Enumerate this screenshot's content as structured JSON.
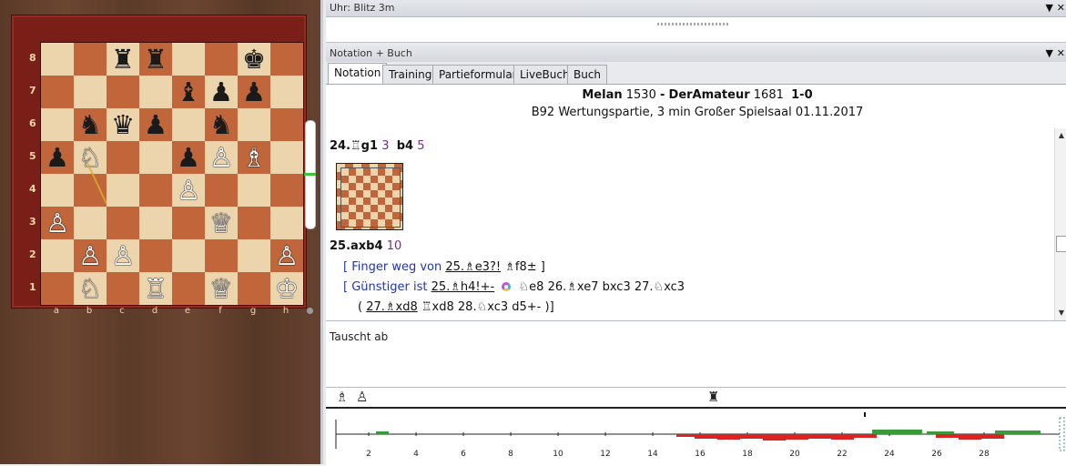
{
  "board": {
    "rank_labels": [
      "8",
      "7",
      "6",
      "5",
      "4",
      "3",
      "2",
      "1"
    ],
    "file_labels": [
      "a",
      "b",
      "c",
      "d",
      "e",
      "f",
      "g",
      "h"
    ],
    "rows": [
      [
        "",
        "",
        "bR",
        "bR",
        "",
        "",
        "bK",
        ""
      ],
      [
        "",
        "",
        "",
        "",
        "bB",
        "bP",
        "bP",
        ""
      ],
      [
        "",
        "bN",
        "bQ",
        "bP",
        "",
        "bN",
        "",
        ""
      ],
      [
        "bP",
        "wN",
        "",
        "",
        "bP",
        "wP",
        "wB",
        ""
      ],
      [
        "",
        "",
        "",
        "",
        "wP",
        "",
        "",
        ""
      ],
      [
        "wP",
        "",
        "",
        "",
        "",
        "wQ",
        "",
        ""
      ],
      [
        "",
        "wP",
        "wP",
        "",
        "",
        "",
        "",
        "wP"
      ],
      [
        "",
        "wN",
        "",
        "wR",
        "",
        "wQ",
        "",
        "wK"
      ]
    ],
    "glyphs": {
      "wK": "♔",
      "wQ": "♕",
      "wR": "♖",
      "wB": "♗",
      "wN": "♘",
      "wP": "♙",
      "bK": "♚",
      "bQ": "♛",
      "bR": "♜",
      "bB": "♝",
      "bN": "♞",
      "bP": "♟"
    }
  },
  "clock_panel": {
    "title": "Uhr: Blitz 3m"
  },
  "notation_panel": {
    "title": "Notation + Buch",
    "tabs": [
      "Notation",
      "Training",
      "Partieformular",
      "LiveBuch",
      "Buch"
    ],
    "active_tab": "Notation",
    "header": {
      "white": "Melan",
      "white_elo": "1530",
      "black": "DerAmateur",
      "black_elo": "1681",
      "result": "1-0",
      "eco": "B92",
      "event": "Wertungspartie, 3 min Großer Spielsaal 01.11.2017"
    },
    "moves": {
      "m24": "24.♖g1",
      "m24_time": "3",
      "m24b": "b4",
      "m24b_time": "5",
      "m25": "25.axb4",
      "m25_time": "10",
      "var1_prefix": "[ Finger weg von",
      "var1_move": "25.♗e3?!",
      "var1_reply": "♗f8± ]",
      "var2_prefix": "[ Günstiger ist",
      "var2_move": "25.♗h4!+-",
      "var2_rest": "♘e8  26.♗xe7  bxc3  27.♘xc3",
      "var3_open": "(",
      "var3_move": "27.♗xd8",
      "var3_rest": "♖xd8  28.♘xc3  d5+- )]"
    },
    "comment": "Tauscht ab"
  },
  "graph": {
    "x_ticks": [
      "2",
      "4",
      "6",
      "8",
      "10",
      "12",
      "14",
      "16",
      "18",
      "20",
      "22",
      "24",
      "26",
      "28"
    ],
    "icons": [
      "♗",
      "♙",
      "♜"
    ]
  }
}
